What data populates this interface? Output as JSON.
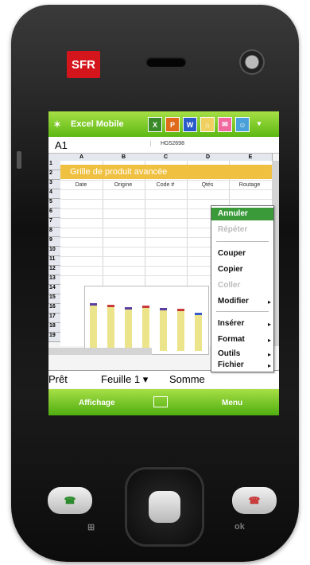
{
  "device": {
    "brand": "SFR",
    "ok_label": "ok"
  },
  "titlebar": {
    "app_title": "Excel Mobile"
  },
  "formula_bar": {
    "cell_ref": "A1",
    "value": "HG52698"
  },
  "sheet": {
    "columns": [
      "A",
      "B",
      "C",
      "D",
      "E"
    ],
    "rows": [
      "1",
      "2",
      "3",
      "4",
      "5",
      "6",
      "7",
      "8",
      "9",
      "10",
      "11",
      "12",
      "13",
      "14",
      "15",
      "16",
      "17",
      "18",
      "19"
    ],
    "banner": "Grille de produit avancée",
    "headers": [
      "Date",
      "Origine",
      "Code #",
      "Qtés",
      "Routage"
    ]
  },
  "statusbar": {
    "ready": "Prêt",
    "sheet_select": "Feuille 1",
    "sum_label": "Somme"
  },
  "softkeys": {
    "left": "Affichage",
    "right": "Menu"
  },
  "menu": {
    "undo": "Annuler",
    "redo": "Répéter",
    "cut": "Couper",
    "copy": "Copier",
    "paste": "Coller",
    "edit": "Modifier",
    "insert": "Insérer",
    "format": "Format",
    "tools": "Outils",
    "file": "Fichier"
  },
  "colors": {
    "accent": "#5cb812",
    "highlight": "#3a9a3a",
    "banner": "#f0c040",
    "brand": "#d4161c"
  }
}
